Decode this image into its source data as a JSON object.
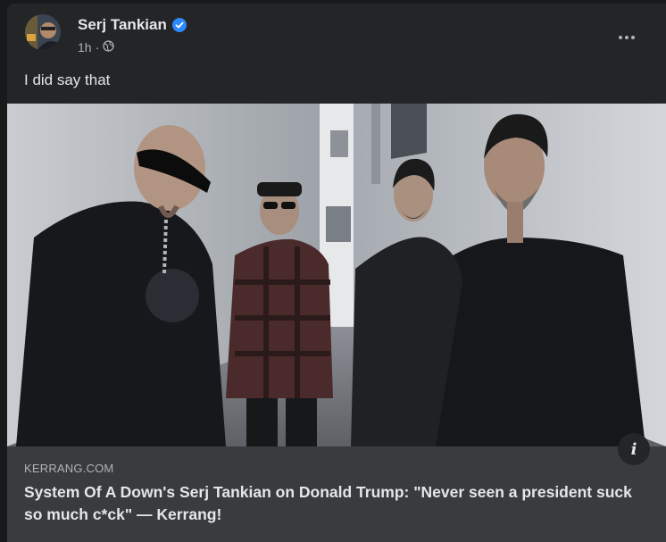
{
  "post": {
    "author": "Serj Tankian",
    "time": "1h",
    "separator": "·",
    "privacy_icon": "globe-icon",
    "verified_icon": "verified-badge-icon",
    "text": "I did say that"
  },
  "link_preview": {
    "domain": "KERRANG.COM",
    "headline": "System Of A Down's Serj Tankian on Donald Trump: \"Never seen a president suck so much c*ck\" — Kerrang!",
    "info_icon": "info-icon",
    "info_label": "i"
  },
  "colors": {
    "background": "#18191a",
    "card": "#242526",
    "link_box": "#3a3b3c",
    "primary_text": "#e4e6eb",
    "secondary_text": "#b0b3b8",
    "verified_blue": "#2d88ff"
  }
}
